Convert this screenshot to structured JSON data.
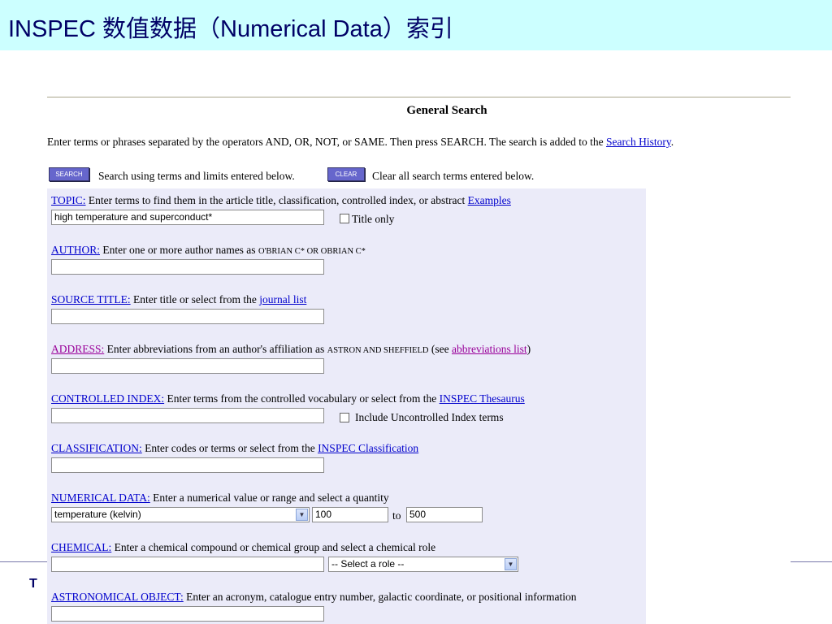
{
  "slide": {
    "title": "INSPEC 数值数据（Numerical Data）索引",
    "footer_logo": "T",
    "header_bg": "#ccffff"
  },
  "search": {
    "heading": "General Search",
    "intro_text": "Enter terms or phrases separated by the operators AND, OR, NOT, or SAME. Then press SEARCH. The search is added to the ",
    "intro_link": "Search History",
    "intro_end": ".",
    "search_button": "SEARCH",
    "search_desc": "Search using terms and limits entered below.",
    "clear_button": "CLEAR",
    "clear_desc": "Clear all search terms entered below."
  },
  "fields": {
    "topic": {
      "label": "TOPIC:",
      "desc": " Enter terms to find them in the article title, classification, controlled index, or abstract  ",
      "link": "Examples",
      "value": "high temperature and superconduct*",
      "checkbox_label": "Title only"
    },
    "author": {
      "label": "AUTHOR:",
      "desc": " Enter one or more author names as ",
      "example": "O'BRIAN C* OR OBRIAN C*",
      "value": ""
    },
    "source_title": {
      "label": "SOURCE TITLE:",
      "desc": " Enter title or select from the ",
      "link": "journal list",
      "value": ""
    },
    "address": {
      "label": "ADDRESS:",
      "desc": " Enter abbreviations from an author's affiliation as ",
      "example": "ASTRON AND SHEFFIELD",
      "desc2": " (see ",
      "link": "abbreviations list",
      "desc3": ")",
      "value": ""
    },
    "controlled_index": {
      "label": "CONTROLLED INDEX:",
      "desc": " Enter terms from the controlled vocabulary or select from the ",
      "link": "INSPEC Thesaurus",
      "value": "",
      "checkbox_label": "Include Uncontrolled Index terms"
    },
    "classification": {
      "label": "CLASSIFICATION:",
      "desc": " Enter codes or terms or select from the ",
      "link": "INSPEC Classification",
      "value": ""
    },
    "numerical_data": {
      "label": "NUMERICAL DATA:",
      "desc": " Enter a numerical value or range and select a quantity",
      "quantity": "temperature (kelvin)",
      "from_value": "100",
      "to_label": "to",
      "to_value": "500"
    },
    "chemical": {
      "label": "CHEMICAL:",
      "desc": " Enter a chemical compound or chemical group and select a chemical role",
      "value": "",
      "role": "-- Select a role --"
    },
    "astronomical_object": {
      "label": "ASTRONOMICAL OBJECT:",
      "desc": " Enter an acronym, catalogue entry number, galactic coordinate, or positional information",
      "value": ""
    }
  },
  "colors": {
    "link": "#0000cc",
    "visited_link": "#990099",
    "panel_bg": "#ebebf9",
    "button_bg": "#6666cc"
  }
}
